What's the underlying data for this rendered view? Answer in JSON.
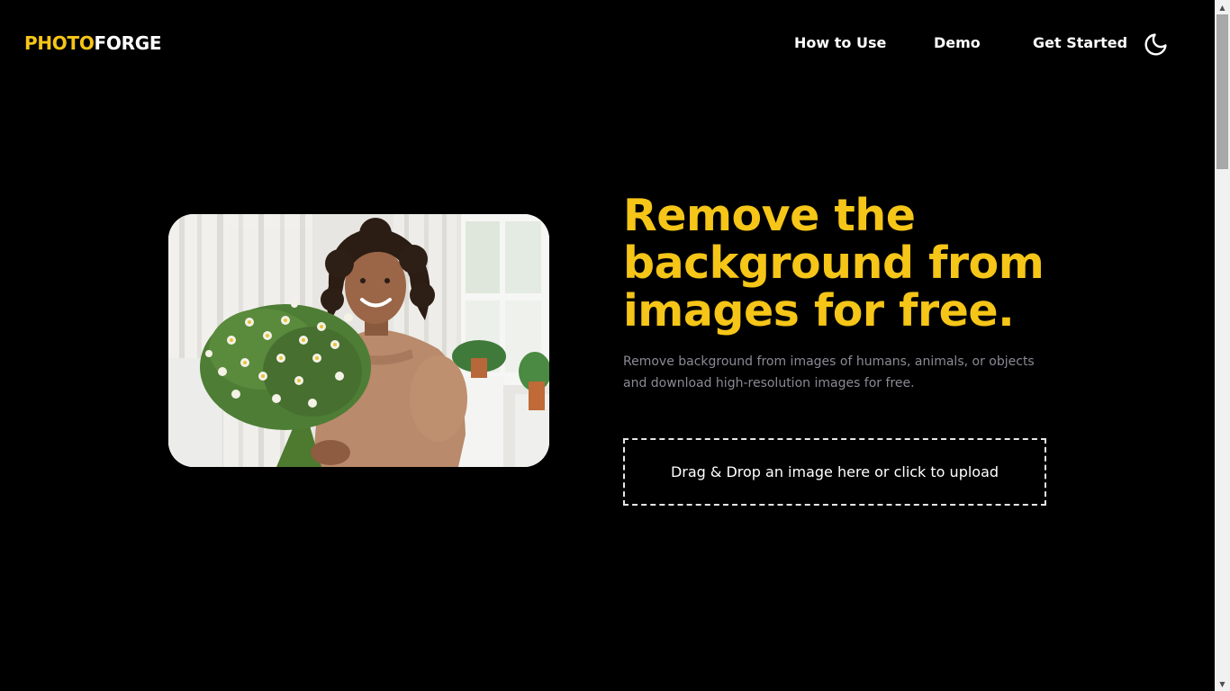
{
  "header": {
    "logo_part1": "PHOTO",
    "logo_part2": "FORGE",
    "nav": {
      "how_to_use": "How to Use",
      "demo": "Demo",
      "get_started": "Get Started"
    },
    "theme_toggle_icon": "moon-icon"
  },
  "hero": {
    "headline": "Remove the background from images for free.",
    "subtext": "Remove background from images of humans, animals, or objects and download high-resolution images for free.",
    "upload_label": "Drag & Drop an image here or click to upload",
    "image_alt": "woman holding a bouquet of daisies"
  },
  "colors": {
    "background": "#000000",
    "accent": "#f5c518",
    "text": "#ffffff",
    "muted": "#8a8a94"
  }
}
